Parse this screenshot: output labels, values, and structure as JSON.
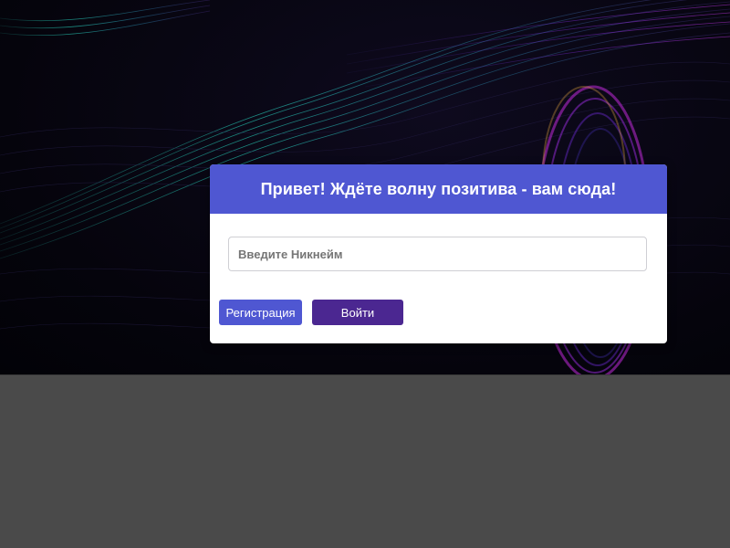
{
  "login_card": {
    "title": "Привет! Ждёте волну позитива - вам сюда!",
    "nickname_placeholder": "Введите Никнейм",
    "register_label": "Регистрация",
    "login_label": "Войти"
  },
  "colors": {
    "header_bg": "#4f57d2",
    "register_button": "#4f57d2",
    "login_button": "#4b2791",
    "page_bottom": "#4a4a4a",
    "wave_teal": "#1fa89a",
    "wave_purple": "#8a2be2"
  },
  "background": {
    "style": "dark abstract waves with teal and purple light rings"
  }
}
